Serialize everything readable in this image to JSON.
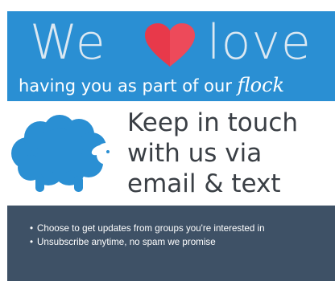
{
  "banner": {
    "headline_we": "We",
    "headline_love": "love",
    "heart_icon": "heart-icon",
    "heart_color": "#e8394a",
    "background": "#2a8fd3",
    "tagline_main": "having you as part of our ",
    "tagline_accent": "flock"
  },
  "promo": {
    "icon": "sheep-icon",
    "icon_color": "#2a8fd3",
    "line1": "Keep in touch",
    "line2": "with us via",
    "line3": "email & text"
  },
  "footer": {
    "background": "#3e5166",
    "bullet_char": "•",
    "items": [
      "Choose to get updates from groups you're interested in",
      "Unsubscribe anytime, no spam we promise"
    ]
  }
}
